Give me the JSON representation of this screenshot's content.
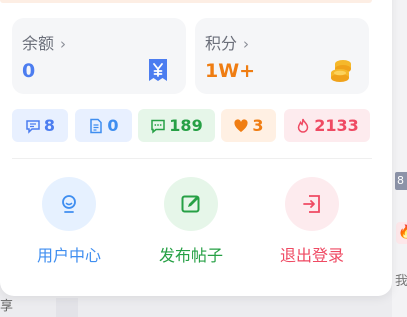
{
  "balance": {
    "title": "余额",
    "value": "0"
  },
  "points": {
    "title": "积分",
    "value": "1W+"
  },
  "stats": [
    {
      "icon": "message-icon",
      "value": "8"
    },
    {
      "icon": "document-icon",
      "value": "0"
    },
    {
      "icon": "comment-icon",
      "value": "189"
    },
    {
      "icon": "heart-icon",
      "value": "3"
    },
    {
      "icon": "fire-icon",
      "value": "2133"
    }
  ],
  "actions": [
    {
      "icon": "user-center-icon",
      "label": "用户中心"
    },
    {
      "icon": "edit-icon",
      "label": "发布帖子"
    },
    {
      "icon": "logout-icon",
      "label": "退出登录"
    }
  ],
  "background": {
    "badge_text": "8",
    "right_char": "我",
    "bottom_char": "享"
  },
  "colors": {
    "blue": "#4c7df0",
    "orange": "#ef7d12",
    "green": "#26a045",
    "red": "#ef4a63"
  }
}
